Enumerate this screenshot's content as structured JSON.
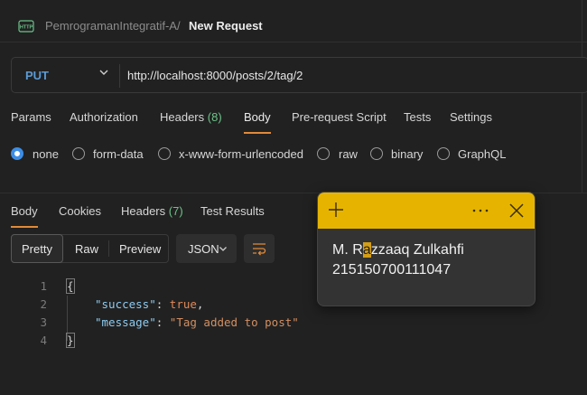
{
  "header": {
    "collection": "PemrogramanIntegratif-A",
    "separator": "/",
    "title": "New Request",
    "icon": "http-icon"
  },
  "request": {
    "method": "PUT",
    "url": "http://localhost:8000/posts/2/tag/2"
  },
  "request_tabs": [
    {
      "label": "Params"
    },
    {
      "label": "Authorization"
    },
    {
      "label": "Headers",
      "count": "(8)"
    },
    {
      "label": "Body",
      "active": true
    },
    {
      "label": "Pre-request Script"
    },
    {
      "label": "Tests"
    },
    {
      "label": "Settings"
    }
  ],
  "body_modes": [
    {
      "label": "none",
      "selected": true
    },
    {
      "label": "form-data"
    },
    {
      "label": "x-www-form-urlencoded"
    },
    {
      "label": "raw"
    },
    {
      "label": "binary"
    },
    {
      "label": "GraphQL"
    }
  ],
  "response_tabs": [
    {
      "label": "Body",
      "active": true
    },
    {
      "label": "Cookies"
    },
    {
      "label": "Headers",
      "count": "(7)"
    },
    {
      "label": "Test Results"
    }
  ],
  "view_modes": [
    "Pretty",
    "Raw",
    "Preview"
  ],
  "format": "JSON",
  "code": {
    "line_numbers": [
      "1",
      "2",
      "3",
      "4"
    ],
    "open_brace": "{",
    "close_brace": "}",
    "key1": "\"success\"",
    "val1": "true",
    "key2": "\"message\"",
    "val2": "\"Tag added to post\"",
    "colon": ": ",
    "comma": ","
  },
  "sticky_note": {
    "line1_a": "M. R",
    "line1_hl": "a",
    "line1_b": "zzaaq Zulkahfi",
    "line2": "215150700111047",
    "accent": "#e6b400"
  },
  "colors": {
    "accent_orange": "#e08a3a",
    "method_blue": "#5b9bd5",
    "count_green": "#6cc38a"
  }
}
